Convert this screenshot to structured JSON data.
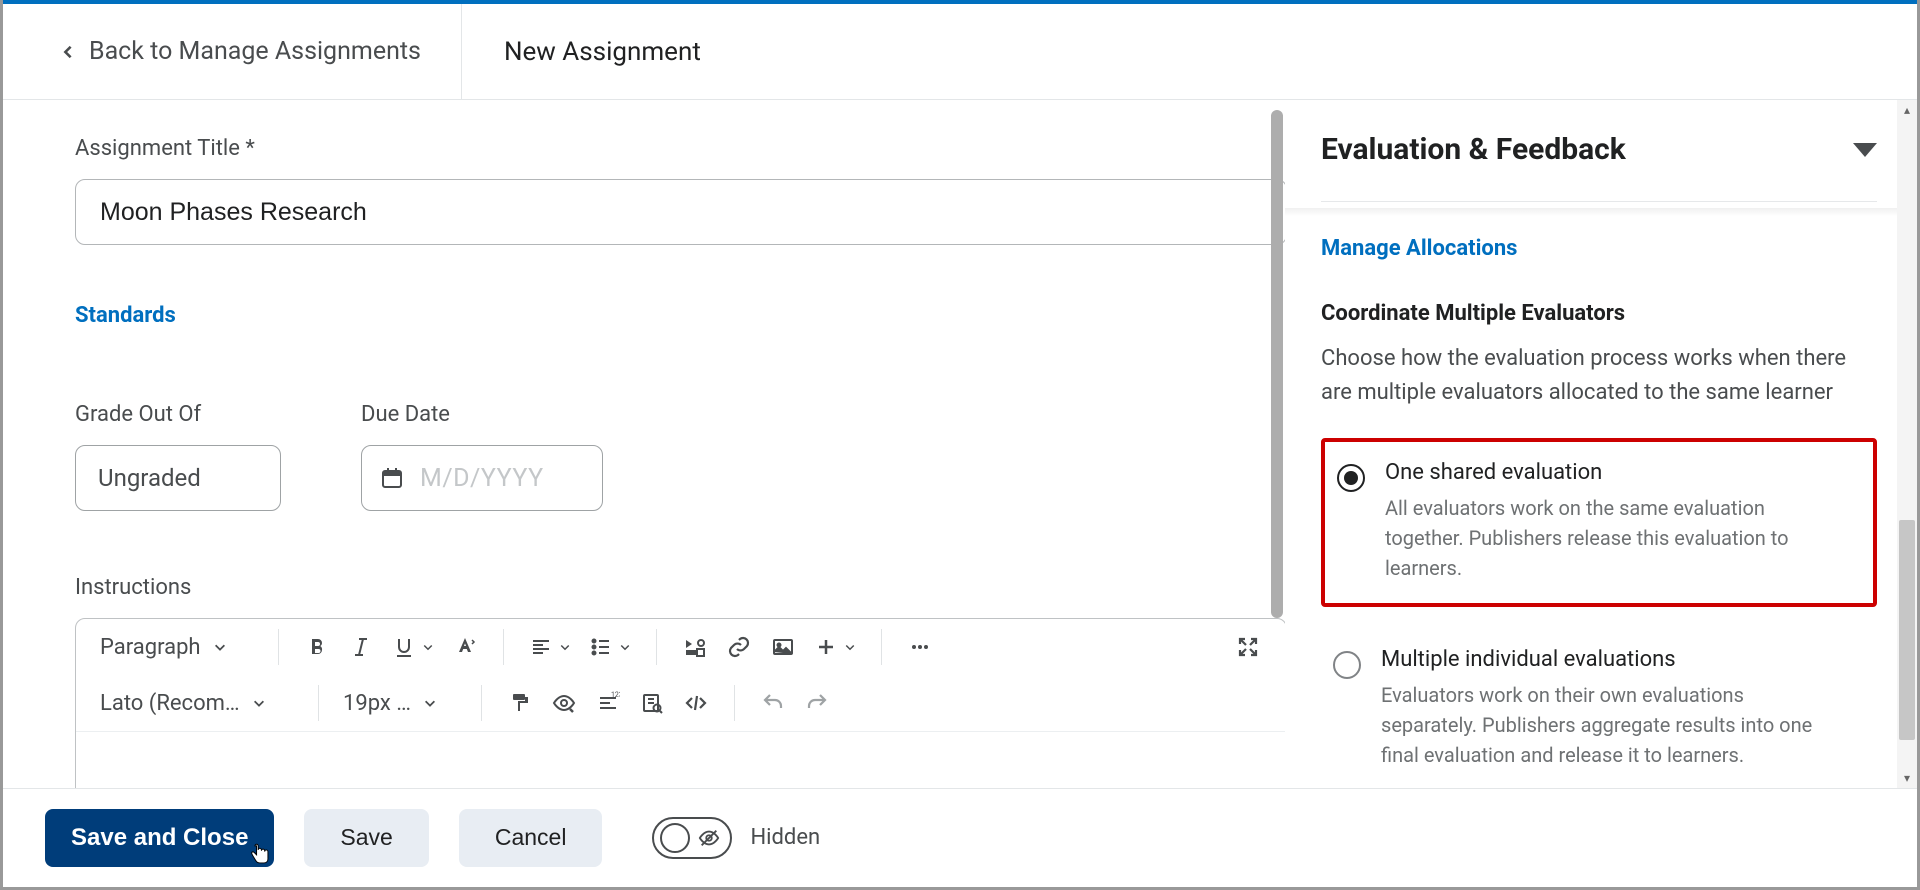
{
  "header": {
    "back_label": "Back to Manage Assignments",
    "title": "New Assignment"
  },
  "main": {
    "title_label": "Assignment Title *",
    "title_value": "Moon Phases Research",
    "standards_link": "Standards",
    "grade_label": "Grade Out Of",
    "grade_value": "Ungraded",
    "due_label": "Due Date",
    "due_placeholder": "M/D/YYYY",
    "instructions_label": "Instructions",
    "editor": {
      "paragraph": "Paragraph",
      "font": "Lato (Recom…",
      "size": "19px …"
    }
  },
  "sidebar": {
    "panel_title": "Evaluation & Feedback",
    "manage_link": "Manage Allocations",
    "section_heading": "Coordinate Multiple Evaluators",
    "section_desc": "Choose how the evaluation process works when there are multiple evaluators allocated to the same learner",
    "options": [
      {
        "title": "One shared evaluation",
        "desc": "All evaluators work on the same evaluation together. Publishers release this evaluation to learners.",
        "checked": true
      },
      {
        "title": "Multiple individual evaluations",
        "desc": "Evaluators work on their own evaluations separately. Publishers aggregate results into one final evaluation and release it to learners.",
        "checked": false
      }
    ]
  },
  "footer": {
    "save_close": "Save and Close",
    "save": "Save",
    "cancel": "Cancel",
    "hidden": "Hidden"
  }
}
